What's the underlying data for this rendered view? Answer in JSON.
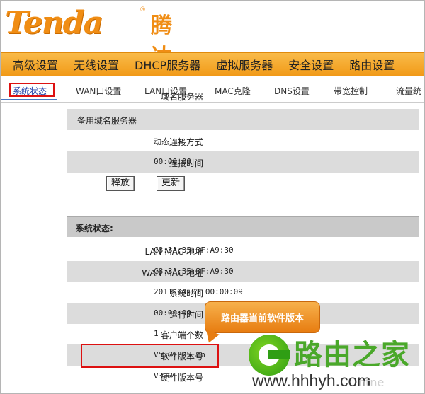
{
  "brand": {
    "logo_en": "Tenda",
    "logo_reg": "®",
    "logo_cn": "腾达"
  },
  "main_nav": [
    "高级设置",
    "无线设置",
    "DHCP服务器",
    "虚拟服务器",
    "安全设置",
    "路由设置"
  ],
  "sub_nav": [
    {
      "label": "系统状态",
      "active": true
    },
    {
      "label": "WAN口设置",
      "active": false
    },
    {
      "label": "LAN口设置",
      "active": false
    },
    {
      "label": "MAC克隆",
      "active": false
    },
    {
      "label": "DNS设置",
      "active": false
    },
    {
      "label": "带宽控制",
      "active": false
    },
    {
      "label": "流量统"
    }
  ],
  "wan": {
    "cut_row": "域名服务器",
    "backup_dns_label": "备用域名服务器",
    "connection_type_label": "连接方式",
    "connection_type_value": "动态 IP",
    "connection_time_label": "连接时间",
    "connection_time_value": "00:00:00",
    "release_button": "释放",
    "renew_button": "更新"
  },
  "system_status": {
    "heading": "系统状态:",
    "rows": [
      {
        "label": "LAN MAC 地址",
        "value": "C8:3A:35:3F:A9:30"
      },
      {
        "label": "WAN MAC 地址",
        "value": "C8:3A:35:3F:A9:30"
      },
      {
        "label": "系统时间",
        "value": "2011-04-01 00:00:09"
      },
      {
        "label": "运行时间",
        "value": "00:00:09"
      },
      {
        "label": "客户端个数",
        "value": "1"
      },
      {
        "label": "软件版本号",
        "value": "V5.07.25_cn"
      },
      {
        "label": "硬件版本号",
        "value": "V3.0"
      }
    ]
  },
  "callout": {
    "text": "路由器当前软件版本"
  },
  "watermark": {
    "title": "路由之家",
    "url": "www.hhhyh.com",
    "faint": "ntne"
  },
  "colors": {
    "brand_orange": "#f08d14",
    "nav_orange": "#f5a623",
    "highlight_red": "#dd1111",
    "watermark_green": "#4aa82a"
  }
}
